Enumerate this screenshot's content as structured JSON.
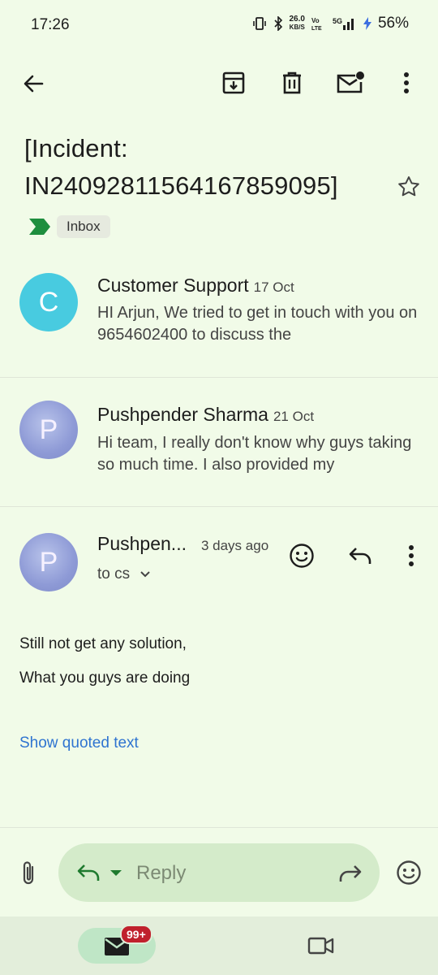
{
  "status_bar": {
    "time": "17:26",
    "speed_value": "26.0",
    "speed_unit": "KB/S",
    "battery": "56%"
  },
  "email": {
    "subject": "[Incident: IN24092811564167859095]",
    "label": "Inbox"
  },
  "messages": [
    {
      "avatar_letter": "C",
      "sender": "Customer Support",
      "date": "17 Oct",
      "snippet": "HI Arjun, We tried to get in touch with you on 9654602400 to discuss the"
    },
    {
      "avatar_letter": "P",
      "sender": "Pushpender Sharma",
      "date": "21 Oct",
      "snippet": "Hi team, I really don't know why guys taking so much time. I also provided my"
    },
    {
      "avatar_letter": "P",
      "sender": "Pushpen...",
      "date": "3 days ago",
      "recipient": "to cs",
      "body": [
        "Still not get any solution,",
        "What you guys are doing"
      ],
      "show_quoted": "Show quoted text"
    }
  ],
  "reply": {
    "placeholder": "Reply"
  },
  "bottom_nav": {
    "mail_badge": "99+"
  },
  "colors": {
    "background": "#f1fbe8",
    "link": "#2f74d0",
    "reply_pill": "#d4ebca",
    "badge": "#c0212d",
    "label_marker": "#1e8e3e"
  }
}
